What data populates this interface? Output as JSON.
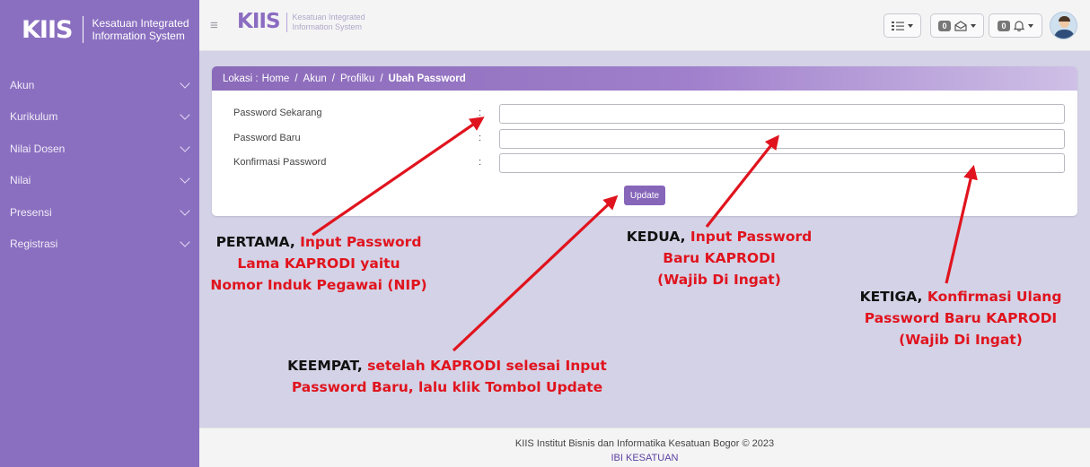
{
  "sidebar": {
    "logo": "KIIS",
    "brand_line1": "Kesatuan Integrated",
    "brand_line2": "Information System",
    "items": [
      {
        "label": "Akun"
      },
      {
        "label": "Kurikulum"
      },
      {
        "label": "Nilai Dosen"
      },
      {
        "label": "Nilai"
      },
      {
        "label": "Presensi"
      },
      {
        "label": "Registrasi"
      }
    ]
  },
  "topbar": {
    "menu_icon": "hamburger-icon",
    "logo": "KIIS",
    "brand_line1": "Kesatuan Integrated",
    "brand_line2": "Information System",
    "messages_count": "0",
    "notifications_count": "0"
  },
  "breadcrumb": {
    "prefix": "Lokasi :",
    "items": [
      "Home",
      "Akun",
      "Profilku",
      "Ubah Password"
    ],
    "separator": "/"
  },
  "form": {
    "fields": [
      {
        "label": "Password Sekarang",
        "value": ""
      },
      {
        "label": "Password Baru",
        "value": ""
      },
      {
        "label": "Konfirmasi Password",
        "value": ""
      }
    ],
    "colon": ":",
    "submit_label": "Update"
  },
  "annotations": {
    "pertama": {
      "bold": "PERTAMA,",
      "red1": "Input Password",
      "red2": "Lama KAPRODI yaitu",
      "red3": "Nomor Induk Pegawai (NIP)"
    },
    "kedua": {
      "bold": "KEDUA,",
      "red1": "Input Password",
      "red2": "Baru KAPRODI",
      "red3": "(Wajib Di Ingat)"
    },
    "ketiga": {
      "bold": "KETIGA,",
      "red1": "Konfirmasi Ulang",
      "red2": "Password Baru KAPRODI",
      "red3": "(Wajib Di Ingat)"
    },
    "keempat": {
      "bold": "KEEMPAT,",
      "red1": "setelah KAPRODI selesai Input",
      "red2": "Password Baru, lalu klik Tombol Update"
    }
  },
  "footer": {
    "copyright": "KIIS Institut Bisnis dan Informatika Kesatuan Bogor © 2023",
    "link": "IBI KESATUAN"
  },
  "colors": {
    "sidebar": "#8a6fc0",
    "accent": "#8666b9",
    "annotation_red": "#e0141e",
    "background": "#d4d2e6"
  }
}
